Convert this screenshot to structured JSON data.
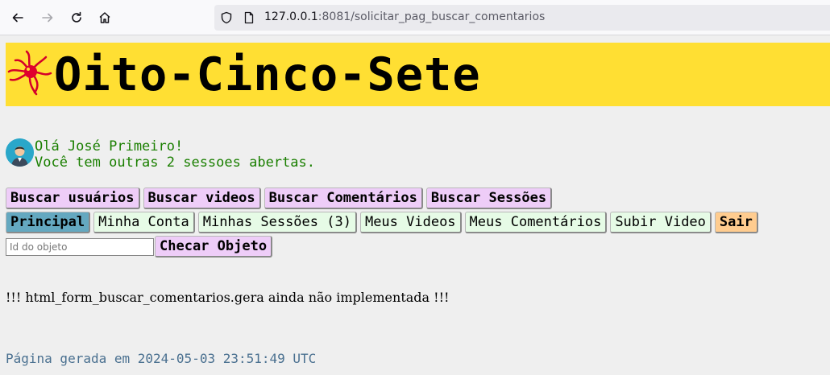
{
  "browser": {
    "url_host": "127.0.0.1",
    "url_rest": ":8081/solicitar_pag_buscar_comentarios"
  },
  "banner": {
    "title": "Oito-Cinco-Sete"
  },
  "greeting": {
    "line1": "Olá José Primeiro!",
    "line2": "Você tem outras 2 sessoes abertas."
  },
  "admin_buttons": {
    "buscar_usuarios": "Buscar usuários",
    "buscar_videos": "Buscar videos",
    "buscar_comentarios": "Buscar Comentários",
    "buscar_sessoes": "Buscar Sessões"
  },
  "menu_buttons": {
    "principal": "Principal",
    "minha_conta": "Minha Conta",
    "minhas_sessoes": "Minhas Sessões (3)",
    "meus_videos": "Meus Videos",
    "meus_comentarios": "Meus Comentários",
    "subir_video": "Subir Video",
    "sair": "Sair"
  },
  "object_check": {
    "placeholder": "Id do objeto",
    "value": "",
    "button": "Checar Objeto"
  },
  "message": "!!! html_form_buscar_comentarios.gera ainda não implementada !!!",
  "footer": "Página gerada em 2024-05-03 23:51:49 UTC",
  "colors": {
    "banner": "#ffdf33",
    "admin_button": "#eecdf8",
    "menu_button": "#e6fbe6",
    "active_button": "#64a8c0",
    "quit_button": "#ffcc8f",
    "greeting_text": "#1a7f00"
  }
}
